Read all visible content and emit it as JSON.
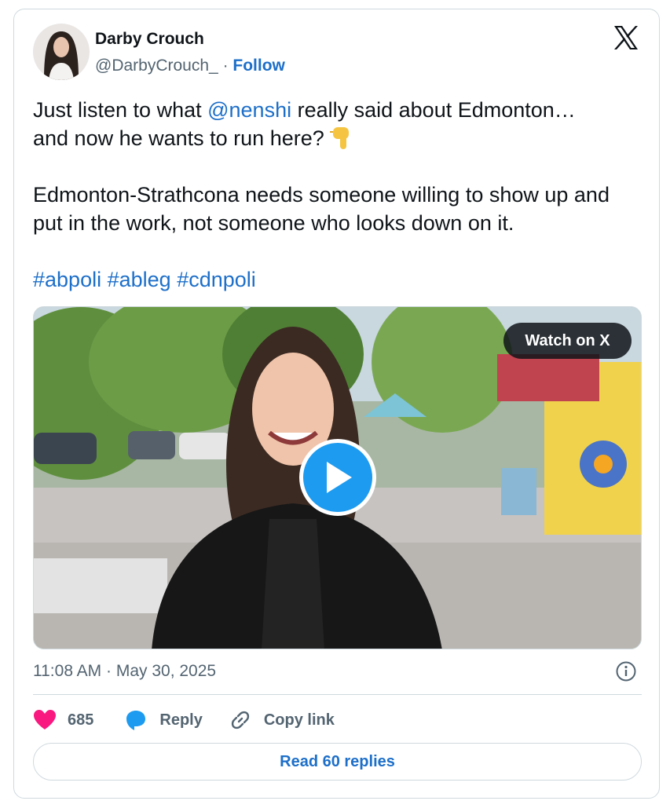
{
  "author": {
    "name": "Darby Crouch",
    "handle": "@DarbyCrouch_",
    "separator": "·",
    "follow_label": "Follow"
  },
  "tweet": {
    "line1_before": "Just listen to what ",
    "mention": "@nenshi",
    "line1_after": " really said about Edmonton…",
    "line2": "and now he wants to run here? ",
    "emoji": "pointing-down-emoji",
    "paragraph2": "Edmonton-Strathcona needs someone willing to show up and put in the work, not someone who looks down on it.",
    "hashtags": [
      "#abpoli",
      "#ableg",
      "#cdnpoli"
    ]
  },
  "media": {
    "watch_label": "Watch on X",
    "icon": "play-icon"
  },
  "meta": {
    "timestamp": "11:08 AM · May 30, 2025"
  },
  "actions": {
    "like_count": "685",
    "reply_label": "Reply",
    "copy_label": "Copy link"
  },
  "read_replies_label": "Read 60 replies",
  "colors": {
    "accent": "#1d6fc9",
    "like": "#f91880",
    "reply_icon": "#1d9bf0",
    "muted": "#536471"
  }
}
